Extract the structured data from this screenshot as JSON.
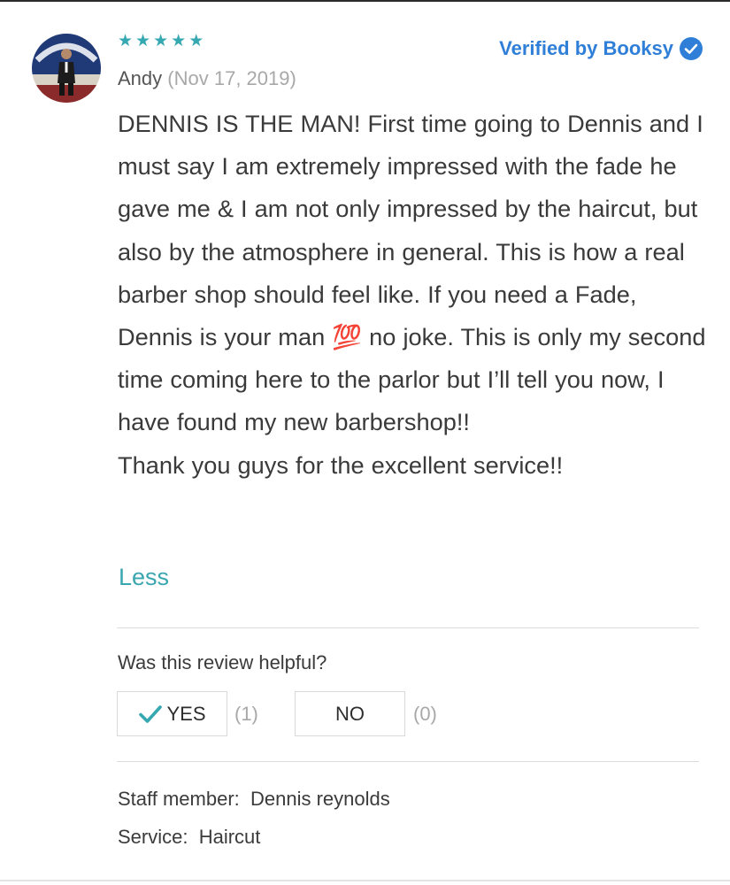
{
  "review": {
    "rating_stars": 5,
    "reviewer_name": "Andy",
    "date": "(Nov 17, 2019)",
    "verified_label": "Verified by Booksy",
    "text": "DENNIS IS THE MAN! First time going to Dennis and I must say I am extremely impressed with the fade he gave me & I am not only impressed by the haircut, but also by the atmosphere in general. This is how a real barber shop should feel like. If you need a Fade, Dennis is your man 💯 no joke. This is only my second time coming here to the parlor but I’ll tell you now, I have found my new barbershop!!\nThank you guys for the excellent service!!",
    "less_label": "Less"
  },
  "helpful": {
    "question": "Was this review helpful?",
    "yes_label": "YES",
    "yes_count": "(1)",
    "no_label": "NO",
    "no_count": "(0)"
  },
  "details": {
    "staff_label": "Staff member:",
    "staff_value": "Dennis reynolds",
    "service_label": "Service:",
    "service_value": "Haircut"
  },
  "colors": {
    "accent_teal": "#36a8b1",
    "verified_blue": "#2f7fd8"
  },
  "icons": {
    "star": "star-icon",
    "verified": "verified-check-badge-icon",
    "yes": "checkmark-icon",
    "avatar": "user-avatar-photo"
  }
}
